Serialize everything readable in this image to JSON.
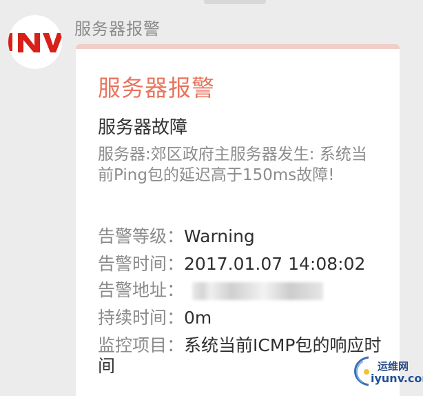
{
  "sender": {
    "name": "服务器报警",
    "avatar_text": "NV"
  },
  "card": {
    "title": "服务器报警",
    "subject": "服务器故障",
    "description": "服务器:郊区政府主服务器发生: 系统当前Ping包的延迟高于150ms故障!",
    "fields": [
      {
        "key": "告警等级：",
        "value": "Warning"
      },
      {
        "key": "告警时间：",
        "value": "2017.01.07 14:08:02"
      },
      {
        "key": "告警地址：",
        "value": ""
      },
      {
        "key": "持续时间：",
        "value": "0m"
      },
      {
        "key": "监控项目：",
        "value": "系统当前ICMP包的响应时间"
      }
    ]
  },
  "watermark": {
    "line1": "运维网",
    "line2": "iyunv.com"
  },
  "colors": {
    "title": "#e8745d",
    "card_top": "#f1cfc8",
    "avatar_red": "#d8201a"
  }
}
